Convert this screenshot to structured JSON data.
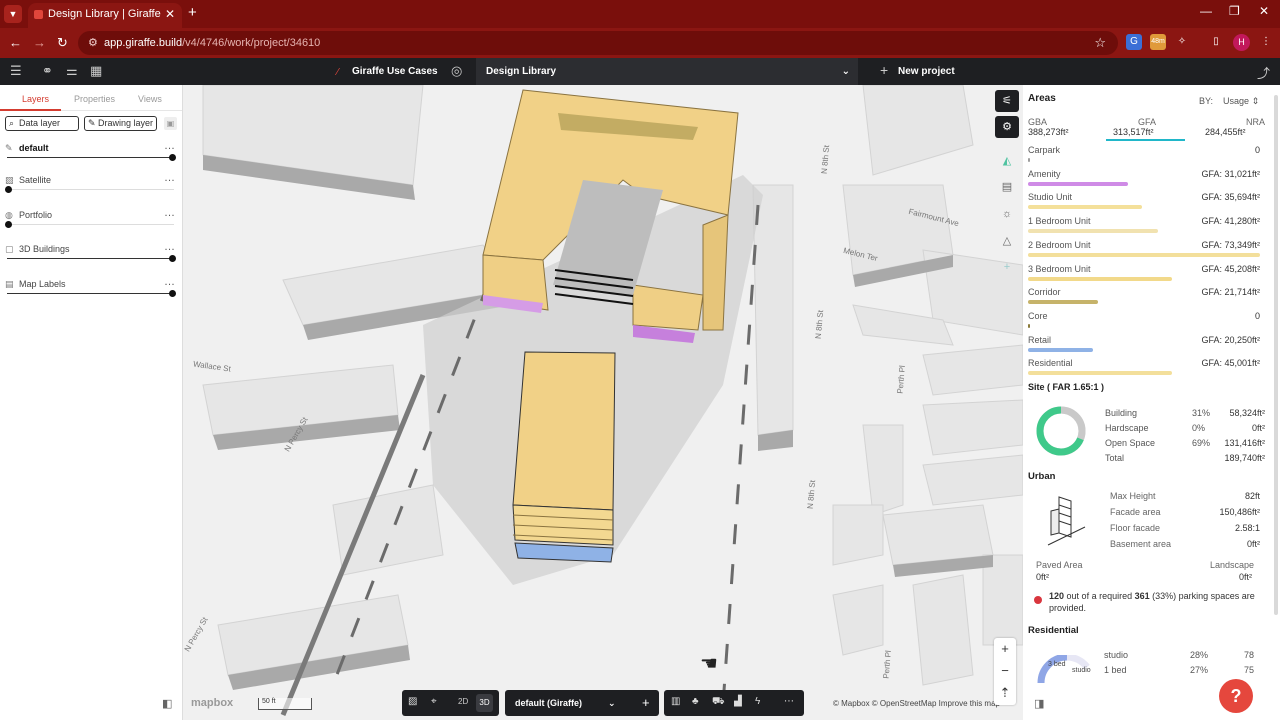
{
  "browser": {
    "tab_title": "Design Library | Giraffe",
    "url_host": "app.giraffe.build",
    "url_path": "/v4/4746/work/project/34610",
    "profile_initial": "H"
  },
  "appbar": {
    "project_name": "Giraffe Use Cases",
    "library_name": "Design Library",
    "new_project": "New project"
  },
  "left_panel": {
    "tabs": [
      "Layers",
      "Properties",
      "Views"
    ],
    "data_layer_btn": "Data layer",
    "drawing_layer_btn": "Drawing layer",
    "layers": [
      {
        "name": "default",
        "opacity": 1.0
      },
      {
        "name": "Satellite",
        "opacity": 0.0
      },
      {
        "name": "Portfolio",
        "opacity": 0.0
      },
      {
        "name": "3D Buildings",
        "opacity": 1.0
      },
      {
        "name": "Map Labels",
        "opacity": 1.0
      }
    ]
  },
  "map": {
    "streets": [
      "Wallace St",
      "N Percy St",
      "N Percy St",
      "N 8th St",
      "N 8th St",
      "N 8th St",
      "Fairmount Ave",
      "Melon Ter",
      "Perth Pl",
      "Perth Pl"
    ],
    "scale": "50 ft",
    "logo": "mapbox",
    "attribution": "© Mapbox © OpenStreetMap",
    "improve": "Improve this map",
    "layout_select": "default (Giraffe)",
    "view_2d": "2D",
    "view_3d": "3D"
  },
  "areas": {
    "title": "Areas",
    "by_label": "BY:",
    "by_value": "Usage",
    "totals": [
      {
        "label": "GBA",
        "value": "388,273ft²"
      },
      {
        "label": "GFA",
        "value": "313,517ft²"
      },
      {
        "label": "NRA",
        "value": "284,455ft²"
      }
    ],
    "rows": [
      {
        "name": "Carpark",
        "gfa": "0",
        "color": "#9e9e9e",
        "share": 0.01
      },
      {
        "name": "Amenity",
        "gfa": "GFA: 31,021ft²",
        "color": "#cf8be6",
        "share": 0.43
      },
      {
        "name": "Studio Unit",
        "gfa": "GFA: 35,694ft²",
        "color": "#f4e09a",
        "share": 0.49
      },
      {
        "name": "1 Bedroom Unit",
        "gfa": "GFA: 41,280ft²",
        "color": "#f1e2b0",
        "share": 0.56
      },
      {
        "name": "2 Bedroom Unit",
        "gfa": "GFA: 73,349ft²",
        "color": "#f3df9b",
        "share": 1.0
      },
      {
        "name": "3 Bedroom Unit",
        "gfa": "GFA: 45,208ft²",
        "color": "#f2d98a",
        "share": 0.62
      },
      {
        "name": "Corridor",
        "gfa": "GFA: 21,714ft²",
        "color": "#c6b36a",
        "share": 0.3
      },
      {
        "name": "Core",
        "gfa": "0",
        "color": "#8a7a3a",
        "share": 0.01
      },
      {
        "name": "Retail",
        "gfa": "GFA: 20,250ft²",
        "color": "#8fb2e6",
        "share": 0.28
      },
      {
        "name": "Residential",
        "gfa": "GFA: 45,001ft²",
        "color": "#f3df9b",
        "share": 0.62
      }
    ]
  },
  "site": {
    "title": "Site ( FAR 1.65:1 )",
    "rows": [
      {
        "label": "Building",
        "pct": "31%",
        "value": "58,324ft²",
        "share": 0.31,
        "color": "#c9c9c9"
      },
      {
        "label": "Hardscape",
        "pct": "0%",
        "value": "0ft²",
        "share": 0.0,
        "color": "#888888"
      },
      {
        "label": "Open Space",
        "pct": "69%",
        "value": "131,416ft²",
        "share": 0.69,
        "color": "#3fc98a"
      },
      {
        "label": "Total",
        "pct": "",
        "value": "189,740ft²"
      }
    ]
  },
  "urban": {
    "title": "Urban",
    "rows": [
      {
        "label": "Max Height",
        "value": "82ft"
      },
      {
        "label": "Facade area",
        "value": "150,486ft²"
      },
      {
        "label": "Floor facade",
        "value": "2.58:1"
      },
      {
        "label": "Basement area",
        "value": "0ft²"
      }
    ],
    "paved_label": "Paved Area",
    "paved_value": "0ft²",
    "landscape_label": "Landscape",
    "landscape_value": "0ft²",
    "parking_provided": "120",
    "parking_mid": "out of a required",
    "parking_required": "361",
    "parking_tail": "(33%) parking spaces are provided."
  },
  "residential": {
    "title": "Residential",
    "donut_labels": [
      "3 bed",
      "studio"
    ],
    "rows": [
      {
        "label": "studio",
        "pct": "28%",
        "value": "78"
      },
      {
        "label": "1 bed",
        "pct": "27%",
        "value": "75"
      }
    ]
  },
  "help": "?"
}
